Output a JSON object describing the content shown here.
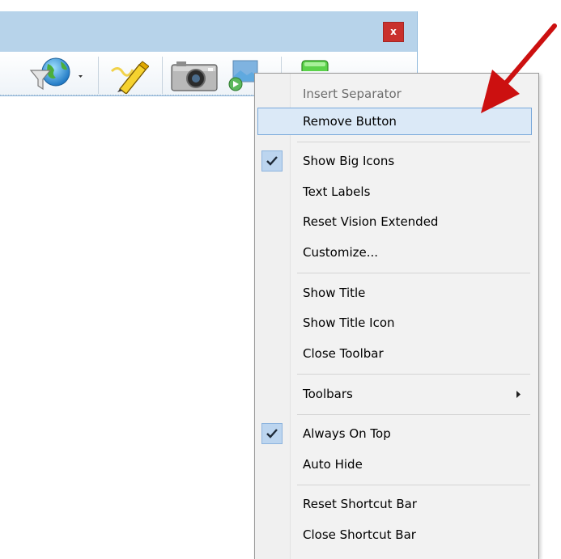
{
  "window": {
    "close_label": "x"
  },
  "toolbar": {
    "buttons": [
      {
        "name": "web-search-icon",
        "tooltip": ""
      },
      {
        "name": "highlighter-icon",
        "tooltip": ""
      },
      {
        "name": "camera-icon",
        "tooltip": ""
      },
      {
        "name": "slideshow-icon",
        "tooltip": ""
      },
      {
        "name": "green-button-icon",
        "tooltip": ""
      }
    ]
  },
  "menu": {
    "items": [
      {
        "label": "Insert Separator",
        "state": "disabled"
      },
      {
        "label": "Remove Button",
        "state": "hover"
      },
      {
        "label": "Show Big Icons",
        "state": "checked"
      },
      {
        "label": "Text Labels",
        "state": "normal"
      },
      {
        "label": "Reset Vision Extended",
        "state": "normal"
      },
      {
        "label": "Customize...",
        "state": "normal"
      },
      {
        "label": "Show Title",
        "state": "normal"
      },
      {
        "label": "Show Title Icon",
        "state": "normal"
      },
      {
        "label": "Close Toolbar",
        "state": "normal"
      },
      {
        "label": "Toolbars",
        "state": "submenu"
      },
      {
        "label": "Always On Top",
        "state": "checked"
      },
      {
        "label": "Auto Hide",
        "state": "normal"
      },
      {
        "label": "Reset Shortcut Bar",
        "state": "normal"
      },
      {
        "label": "Close Shortcut Bar",
        "state": "normal"
      }
    ]
  },
  "colors": {
    "title_bar": "#b7d3ea",
    "close_button": "#c9302c",
    "menu_background": "#f2f2f2",
    "hover_fill": "#dbe9f7",
    "hover_border": "#79a8da",
    "check_fill": "#bcd5ef",
    "annotation_arrow": "#cc1010"
  }
}
